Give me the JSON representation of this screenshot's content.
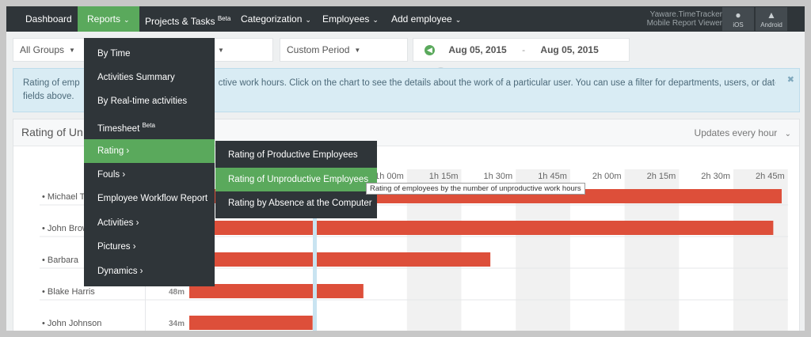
{
  "nav": {
    "items": [
      {
        "label": "Dashboard"
      },
      {
        "label": "Reports"
      },
      {
        "label": "Projects & Tasks",
        "badge": "Beta"
      },
      {
        "label": "Categorization"
      },
      {
        "label": "Employees"
      },
      {
        "label": "Add employee"
      }
    ],
    "brand_line1": "Yaware.TimeTracker",
    "brand_line2": "Mobile Report Viewer",
    "ios_label": "iOS",
    "android_label": "Android"
  },
  "filters": {
    "groups": "All Groups",
    "users_caret_fragment": "s",
    "period": "Custom Period",
    "date_from": "Aug 05, 2015",
    "date_sep": "-",
    "date_to": "Aug 05, 2015"
  },
  "info": {
    "text_start": "Rating of emp",
    "text_end": "ctive work hours. Click on the chart to see the details about the work of a particular user. You can use a filter for departments, users, or date, using the",
    "text_line2": "fields above."
  },
  "panel": {
    "title": "Rating of Un",
    "updates": "Updates every hour"
  },
  "chart_data": {
    "type": "bar",
    "orientation": "horizontal",
    "ticks": [
      "1h 00m",
      "1h 15m",
      "1h 30m",
      "1h 45m",
      "2h 00m",
      "2h 15m",
      "2h 30m",
      "2h 45m"
    ],
    "rows": [
      {
        "name": "Michael T",
        "duration": "",
        "minutes": 165
      },
      {
        "name": "John Brow",
        "duration": "",
        "minutes": 161
      },
      {
        "name": "Barbara",
        "duration": "",
        "minutes": 83
      },
      {
        "name": "Blake Harris",
        "duration": "48m",
        "minutes": 48
      },
      {
        "name": "John Johnson",
        "duration": "34m",
        "minutes": 34
      }
    ]
  },
  "menu": {
    "items": [
      {
        "label": "By Time"
      },
      {
        "label": "Activities Summary"
      },
      {
        "label": "By Real-time activities"
      },
      {
        "label": "Timesheet",
        "badge": "Beta"
      },
      {
        "label": "Rating ›"
      },
      {
        "label": "Fouls ›"
      },
      {
        "label": "Employee Workflow Report"
      },
      {
        "label": "Activities ›"
      },
      {
        "label": "Pictures ›"
      },
      {
        "label": "Dynamics ›"
      }
    ],
    "submenu": [
      {
        "label": "Rating of Productive Employees"
      },
      {
        "label": "Rating of Unproductive Employees"
      },
      {
        "label": "Rating by Absence at the Computer"
      }
    ],
    "tooltip": "Rating of employees by the number of unproductive work hours"
  },
  "colors": {
    "nav_bg": "#2f3539",
    "accent_green": "#5aa95c",
    "bar_red": "#dd4f3a",
    "info_bg": "#d9ecf4"
  }
}
